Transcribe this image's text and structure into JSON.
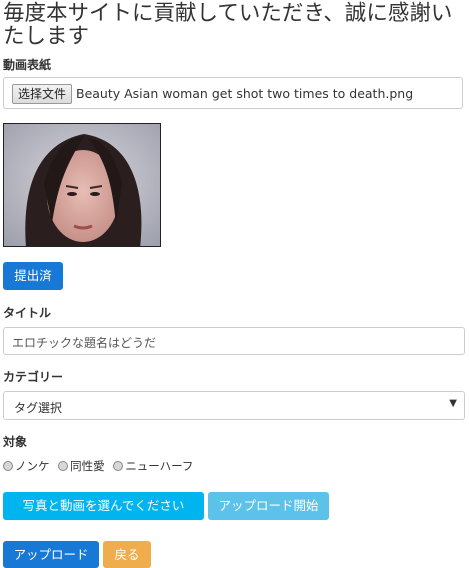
{
  "page_title": "毎度本サイトに貢献していただき、誠に感謝いたします",
  "video_cover": {
    "label": "動画表紙",
    "choose_file_button": "选择文件",
    "file_name": "Beauty Asian woman get shot two times to death.png"
  },
  "submitted_button": "提出済",
  "title_field": {
    "label": "タイトル",
    "placeholder": "エロチックな題名はどうだ"
  },
  "category": {
    "label": "カテゴリー",
    "selected": "タグ選択"
  },
  "target": {
    "label": "対象",
    "options": [
      "ノンケ",
      "同性愛",
      "ニューハーフ"
    ]
  },
  "buttons": {
    "choose_media": "写真と動画を選んでください",
    "start_upload": "アップロード開始",
    "upload": "アップロード",
    "back": "戻る"
  },
  "colors": {
    "primary": "#1878d6",
    "info": "#00b4ef",
    "info_light": "#5dc2ea",
    "warning": "#f0ad4e"
  }
}
